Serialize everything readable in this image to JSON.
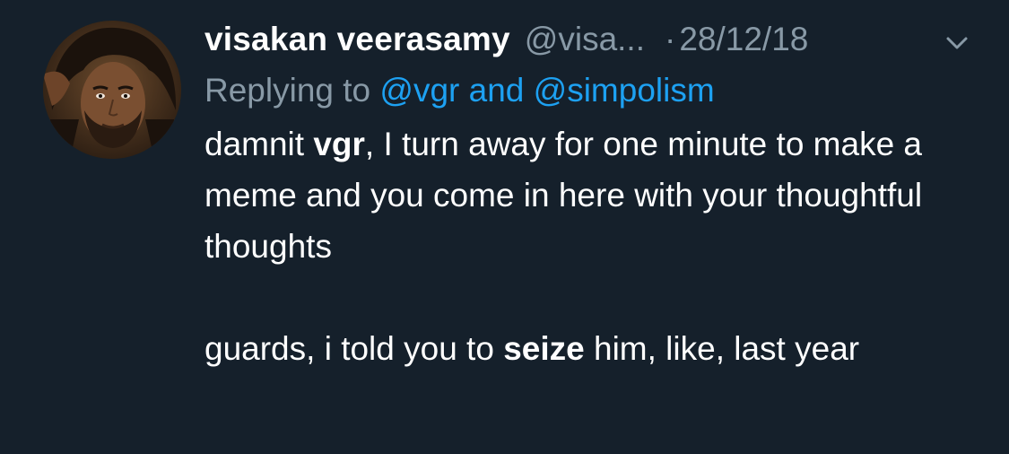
{
  "tweet": {
    "display_name": "visakan veerasamy",
    "handle": "@visa...",
    "separator": "·",
    "date": "28/12/18",
    "caret_icon": "chevron-down-icon",
    "replying_prefix": "Replying to",
    "reply_mention_1": "@vgr",
    "reply_and": "and",
    "reply_mention_2": "@simpolism",
    "body": {
      "p1_part1": "damnit ",
      "p1_bold": "vgr",
      "p1_part2": ", I turn away for one minute to make a meme and you come in here with your thoughtful thoughts",
      "p2_part1": "guards, i told you to ",
      "p2_bold": "seize",
      "p2_part2": " him, like, last year"
    }
  },
  "colors": {
    "background": "#15202b",
    "primary_text": "#ffffff",
    "secondary_text": "#8899a6",
    "link": "#1da1f2"
  }
}
